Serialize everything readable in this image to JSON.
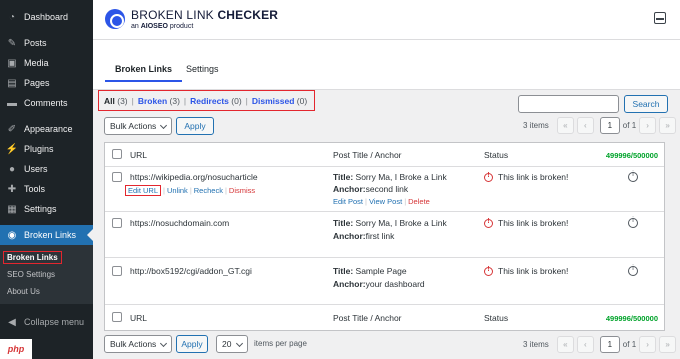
{
  "sidebar": {
    "items": [
      {
        "label": "Dashboard",
        "icon": "dashboard-icon"
      },
      {
        "label": "Posts",
        "icon": "pushpin-icon"
      },
      {
        "label": "Media",
        "icon": "media-icon"
      },
      {
        "label": "Pages",
        "icon": "page-icon"
      },
      {
        "label": "Comments",
        "icon": "comment-icon"
      },
      {
        "label": "Appearance",
        "icon": "brush-icon"
      },
      {
        "label": "Plugins",
        "icon": "plug-icon"
      },
      {
        "label": "Users",
        "icon": "user-icon"
      },
      {
        "label": "Tools",
        "icon": "wrench-icon"
      },
      {
        "label": "Settings",
        "icon": "settings-icon"
      },
      {
        "label": "Broken Links",
        "icon": "broken-link-icon"
      }
    ],
    "submenu": [
      "Broken Links",
      "SEO Settings",
      "About Us"
    ],
    "collapse_label": "Collapse menu"
  },
  "header": {
    "title_light": "BROKEN LINK ",
    "title_bold": "CHECKER",
    "subtitle_pre": "an ",
    "subtitle_brand": "AIOSEO",
    "subtitle_post": " product"
  },
  "tabs": [
    "Broken Links",
    "Settings"
  ],
  "filters": {
    "all": "All",
    "all_count": "(3)",
    "broken": "Broken",
    "broken_count": "(3)",
    "redirects": "Redirects",
    "redirects_count": "(0)",
    "dismissed": "Dismissed",
    "dismissed_count": "(0)",
    "sep": "|"
  },
  "search": {
    "button": "Search",
    "placeholder": ""
  },
  "bulk": {
    "select": "Bulk Actions",
    "apply": "Apply"
  },
  "pagination": {
    "items": "3 items",
    "page": "1",
    "of": "of 1",
    "first": "«",
    "prev": "‹",
    "next": "›",
    "last": "»"
  },
  "table": {
    "col_url": "URL",
    "col_post": "Post Title / Anchor",
    "col_status": "Status",
    "quota": "499996/500000",
    "title_label": "Title:",
    "anchor_label": "Anchor:",
    "rows": [
      {
        "url": "https://wikipedia.org/nosucharticle",
        "title": "Sorry Ma, I Broke a Link",
        "anchor": "second link",
        "status": "This link is broken!"
      },
      {
        "url": "https://nosuchdomain.com",
        "title": "Sorry Ma, I Broke a Link",
        "anchor": "first link",
        "status": "This link is broken!"
      },
      {
        "url": "http://box5192/cgi/addon_GT.cgi",
        "title": "Sample Page",
        "anchor": "your dashboard",
        "status": "This link is broken!"
      }
    ],
    "row_actions": {
      "edit_url": "Edit URL",
      "unlink": "Unlink",
      "recheck": "Recheck",
      "dismiss": "Dismiss"
    },
    "post_actions": {
      "edit_post": "Edit Post",
      "view_post": "View Post",
      "delete": "Delete"
    }
  },
  "bottom": {
    "per_page": "20",
    "per_page_label": "items per page"
  },
  "watermark": "php"
}
